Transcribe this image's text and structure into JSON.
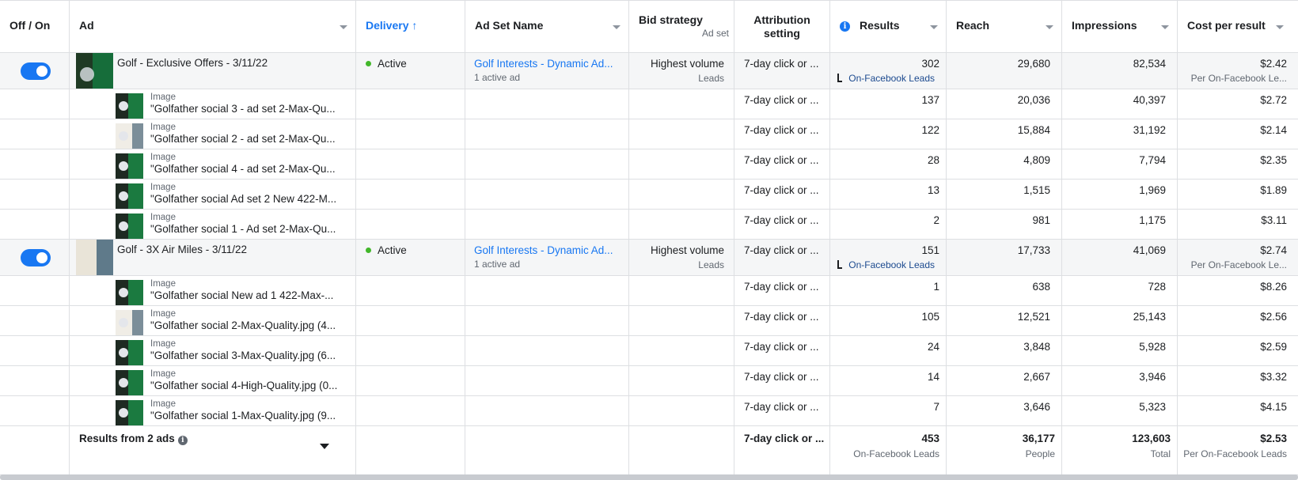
{
  "header": {
    "off_on": "Off / On",
    "ad": "Ad",
    "delivery": "Delivery",
    "delivery_sort_icon": "arrow-up-icon",
    "ad_set_name": "Ad Set Name",
    "bid_strategy": "Bid strategy",
    "bid_strategy_sub": "Ad set",
    "attribution": "Attribution setting",
    "results": "Results",
    "reach": "Reach",
    "impressions": "Impressions",
    "cost_per_result": "Cost per result"
  },
  "colors": {
    "accent": "#1877f2",
    "active": "#42b72a"
  },
  "adsets": [
    {
      "name": "Golf - Exclusive Offers - 3/11/22",
      "delivery": "Active",
      "ad_set_name": "Golf Interests - Dynamic Ad...",
      "ad_set_sub": "1 active ad",
      "bid": "Highest volume",
      "bid_sub": "Leads",
      "attribution": "7-day click or ...",
      "results": "302",
      "results_sub": "On-Facebook Leads",
      "reach": "29,680",
      "impressions": "82,534",
      "cost": "$2.42",
      "cost_sub": "Per On-Facebook Le...",
      "ads": [
        {
          "type": "Image",
          "name": "\"Golfather social 3 - ad set 2-Max-Qu...",
          "attribution": "7-day click or ...",
          "results": "137",
          "reach": "20,036",
          "impressions": "40,397",
          "cost": "$2.72"
        },
        {
          "type": "Image",
          "name": "\"Golfather social 2 - ad set 2-Max-Qu...",
          "attribution": "7-day click or ...",
          "results": "122",
          "reach": "15,884",
          "impressions": "31,192",
          "cost": "$2.14"
        },
        {
          "type": "Image",
          "name": "\"Golfather social 4 - ad set 2-Max-Qu...",
          "attribution": "7-day click or ...",
          "results": "28",
          "reach": "4,809",
          "impressions": "7,794",
          "cost": "$2.35"
        },
        {
          "type": "Image",
          "name": "\"Golfather social Ad set 2 New 422-M...",
          "attribution": "7-day click or ...",
          "results": "13",
          "reach": "1,515",
          "impressions": "1,969",
          "cost": "$1.89"
        },
        {
          "type": "Image",
          "name": "\"Golfather social 1 - Ad set 2-Max-Qu...",
          "attribution": "7-day click or ...",
          "results": "2",
          "reach": "981",
          "impressions": "1,175",
          "cost": "$3.11"
        }
      ]
    },
    {
      "name": "Golf - 3X Air Miles - 3/11/22",
      "delivery": "Active",
      "ad_set_name": "Golf Interests - Dynamic Ad...",
      "ad_set_sub": "1 active ad",
      "bid": "Highest volume",
      "bid_sub": "Leads",
      "attribution": "7-day click or ...",
      "results": "151",
      "results_sub": "On-Facebook Leads",
      "reach": "17,733",
      "impressions": "41,069",
      "cost": "$2.74",
      "cost_sub": "Per On-Facebook Le...",
      "ads": [
        {
          "type": "Image",
          "name": "\"Golfather social New ad 1 422-Max-...",
          "attribution": "7-day click or ...",
          "results": "1",
          "reach": "638",
          "impressions": "728",
          "cost": "$8.26"
        },
        {
          "type": "Image",
          "name": "\"Golfather social 2-Max-Quality.jpg (4...",
          "attribution": "7-day click or ...",
          "results": "105",
          "reach": "12,521",
          "impressions": "25,143",
          "cost": "$2.56"
        },
        {
          "type": "Image",
          "name": "\"Golfather social 3-Max-Quality.jpg (6...",
          "attribution": "7-day click or ...",
          "results": "24",
          "reach": "3,848",
          "impressions": "5,928",
          "cost": "$2.59"
        },
        {
          "type": "Image",
          "name": "\"Golfather social 4-High-Quality.jpg (0...",
          "attribution": "7-day click or ...",
          "results": "14",
          "reach": "2,667",
          "impressions": "3,946",
          "cost": "$3.32"
        },
        {
          "type": "Image",
          "name": "\"Golfather social 1-Max-Quality.jpg (9...",
          "attribution": "7-day click or ...",
          "results": "7",
          "reach": "3,646",
          "impressions": "5,323",
          "cost": "$4.15"
        }
      ]
    }
  ],
  "summary": {
    "label": "Results from 2 ads",
    "attribution": "7-day click or ...",
    "results": "453",
    "results_sub": "On-Facebook Leads",
    "reach": "36,177",
    "reach_sub": "People",
    "impressions": "123,603",
    "impressions_sub": "Total",
    "cost": "$2.53",
    "cost_sub": "Per On-Facebook Leads"
  }
}
